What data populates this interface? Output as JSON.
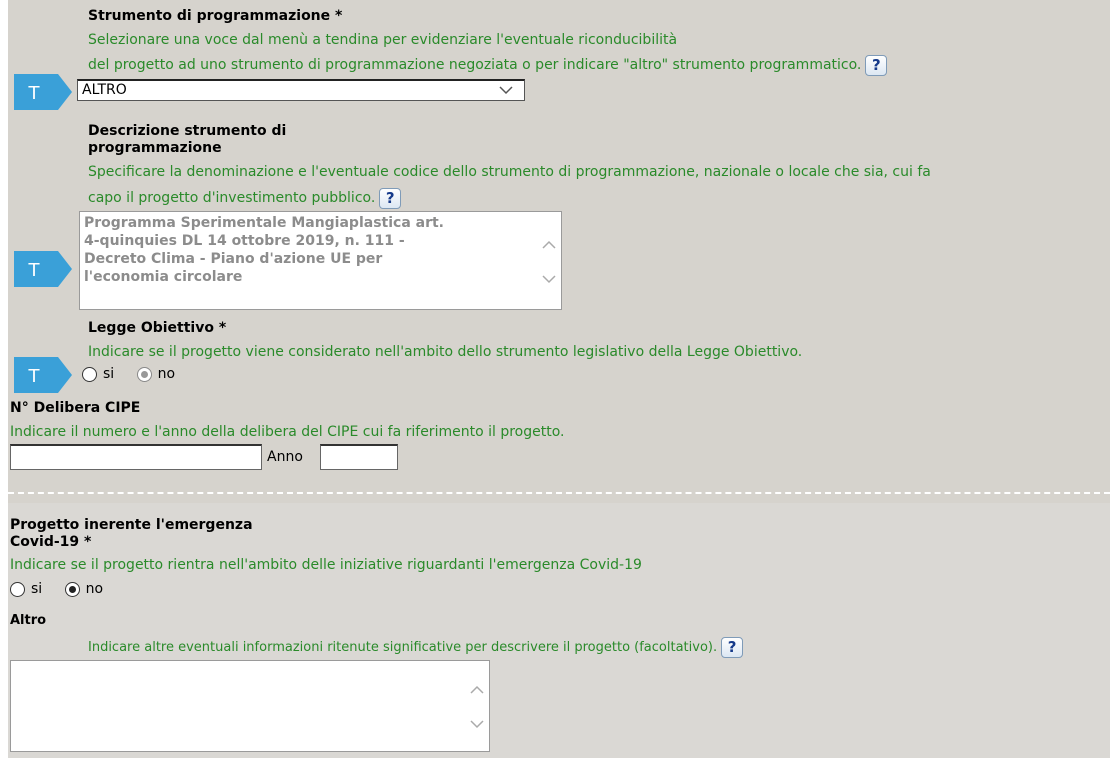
{
  "strumento": {
    "label": "Strumento di programmazione *",
    "hint_line1": "Selezionare una voce dal menù a tendina per evidenziare l'eventuale riconducibilità",
    "hint_line2": "del progetto ad uno strumento di programmazione negoziata o per indicare \"altro\" strumento programmatico.",
    "selected": "ALTRO"
  },
  "descrizione": {
    "label_line1": "Descrizione strumento di",
    "label_line2": "programmazione",
    "hint_line1": "Specificare la denominazione e l'eventuale codice dello strumento di programmazione, nazionale o locale che sia, cui fa",
    "hint_line2": "capo il progetto d'investimento pubblico.",
    "value_lines": [
      "Programma Sperimentale Mangiaplastica art.",
      "4-quinquies DL 14 ottobre 2019, n. 111 -",
      "Decreto Clima - Piano d'azione UE per",
      "l'economia circolare"
    ]
  },
  "legge": {
    "label": "Legge Obiettivo *",
    "hint": "Indicare se il progetto viene considerato nell'ambito dello strumento legislativo della Legge Obiettivo.",
    "opt_si": "si",
    "opt_no": "no",
    "selected": "no"
  },
  "delibera": {
    "label": "N° Delibera CIPE",
    "hint": "Indicare il numero e l'anno della delibera del CIPE cui fa riferimento il progetto.",
    "anno_label": "Anno",
    "numero_value": "",
    "anno_value": ""
  },
  "covid": {
    "label_line1": "Progetto inerente l'emergenza",
    "label_line2": "Covid-19 *",
    "hint": "Indicare se il progetto rientra nell'ambito delle iniziative riguardanti l'emergenza Covid-19",
    "opt_si": "si",
    "opt_no": "no",
    "selected": "no"
  },
  "altro": {
    "label": "Altro",
    "hint": "Indicare altre eventuali informazioni ritenute significative per descrivere il progetto (facoltativo).",
    "value": ""
  },
  "badges": {
    "text": "T",
    "color": "#3aa0d8"
  },
  "help_icon": "?",
  "colors": {
    "hint": "#2a8a2a",
    "background": "#d6d3cd",
    "help_text": "#163a8a"
  }
}
